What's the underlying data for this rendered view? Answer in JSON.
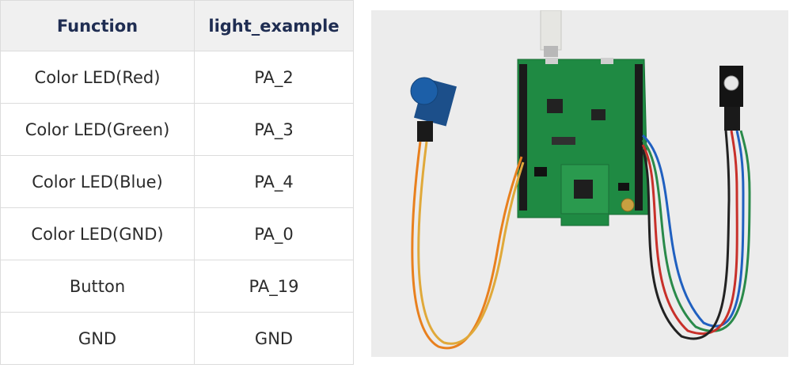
{
  "table": {
    "headers": [
      "Function",
      "light_example"
    ],
    "rows": [
      [
        "Color LED(Red)",
        "PA_2"
      ],
      [
        "Color LED(Green)",
        "PA_3"
      ],
      [
        "Color LED(Blue)",
        "PA_4"
      ],
      [
        "Color LED(GND)",
        "PA_0"
      ],
      [
        "Button",
        "PA_19"
      ],
      [
        "GND",
        "GND"
      ]
    ]
  },
  "colors": {
    "board": "#1f8a43",
    "header_bg": "#f0f0f0",
    "header_text": "#1f2d52",
    "button_cap": "#1c5fa8",
    "wire_orange": "#e8801e",
    "wire_yellow": "#e0a93a",
    "wire_red": "#c8302a",
    "wire_green": "#2a8a4a",
    "wire_blue": "#2060c0",
    "wire_black": "#222222"
  }
}
